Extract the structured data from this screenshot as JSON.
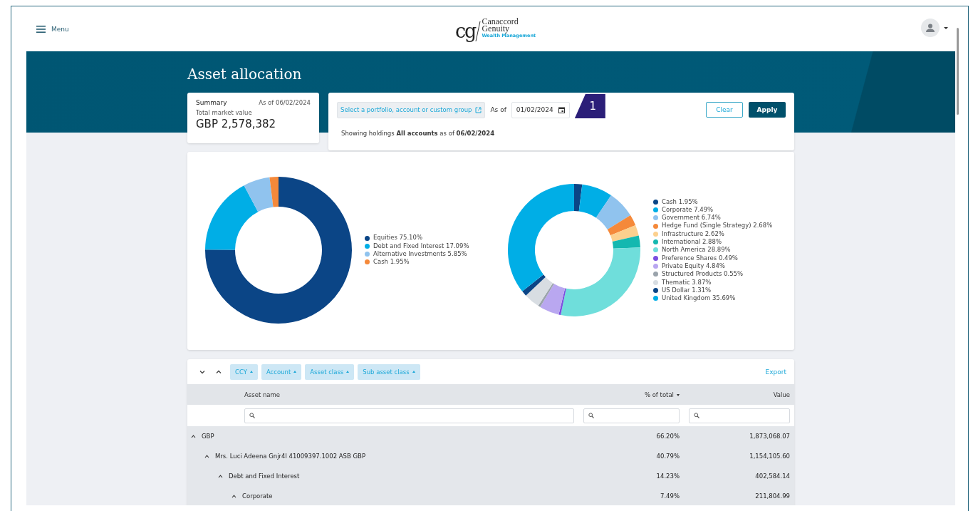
{
  "header": {
    "menu_label": "Menu",
    "logo": {
      "mark": "cg",
      "line_1": "Canaccord",
      "line_2": "Genuity",
      "tagline": "Wealth Management"
    }
  },
  "page_title": "Asset allocation",
  "summary": {
    "title": "Summary",
    "as_of": "As of 06/02/2024",
    "label": "Total market value",
    "value": "GBP 2,578,382"
  },
  "filter": {
    "select_button": "Select a portfolio, account or custom group",
    "as_of_label": "As of",
    "date": "01/02/2024",
    "callout": "1",
    "clear_button": "Clear",
    "apply_button": "Apply",
    "status": "Showing holdings **All accounts** as of **06/02/2024**"
  },
  "charts": [
    {
      "chart_data": {
        "type": "donut",
        "categories": [
          "Equities 75.10%",
          "Debt and Fixed Interest 17.09%",
          "Alternative Investments 5.85%",
          "Cash 1.95%"
        ],
        "legend": true,
        "series": [
          {
            "values": [
              75.1,
              17.09,
              5.85,
              1.95
            ],
            "colors": [
              "#0b4586",
              "#00aee6",
              "#90c3ee",
              "#f5893a"
            ]
          }
        ]
      }
    },
    {
      "chart_data": {
        "type": "donut",
        "categories": [
          "Cash 1.95%",
          "Corporate 7.49%",
          "Government 6.74%",
          "Hedge Fund (Single Strategy) 2.68%",
          "Infrastructure 2.62%",
          "International 2.88%",
          "North America 28.89%",
          "Preference Shares 0.49%",
          "Private Equity 4.84%",
          "Structured Products 0.55%",
          "Thematic 3.87%",
          "US Dollar 1.31%",
          "United Kingdom 35.69%"
        ],
        "legend": true,
        "series": [
          {
            "values": [
              1.95,
              7.49,
              6.74,
              2.68,
              2.62,
              2.88,
              28.89,
              0.49,
              4.84,
              0.55,
              3.87,
              1.31,
              35.69
            ],
            "colors": [
              "#0b4586",
              "#00aee6",
              "#90c3ee",
              "#f5893a",
              "#fcd08e",
              "#14b8b0",
              "#6fdedb",
              "#7b4fe0",
              "#b9a7f0",
              "#9aa3ab",
              "#d8dde2",
              "#0b4586",
              "#00aee6"
            ]
          }
        ]
      }
    }
  ],
  "toolbar": {
    "groups": [
      "CCY",
      "Account",
      "Asset class",
      "Sub asset class"
    ],
    "export": "Export"
  },
  "table": {
    "columns": [
      "Asset name",
      "% of total",
      "Value"
    ],
    "rows": [
      {
        "name": "GBP",
        "percent": "66.20%",
        "value": "1,873,068.07",
        "expanded": true,
        "children": [
          {
            "name": "Mrs. Luci Adeena Gnjr4l 41009397.1002 ASB GBP",
            "percent": "40.79%",
            "value": "1,154,105.60",
            "expanded": true,
            "children": [
              {
                "name": "Debt and Fixed Interest",
                "percent": "14.23%",
                "value": "402,584.14",
                "expanded": true,
                "children": [
                  {
                    "name": "Corporate",
                    "percent": "7.49%",
                    "value": "211,804.99",
                    "expanded": true
                  }
                ]
              }
            ]
          }
        ]
      }
    ]
  }
}
